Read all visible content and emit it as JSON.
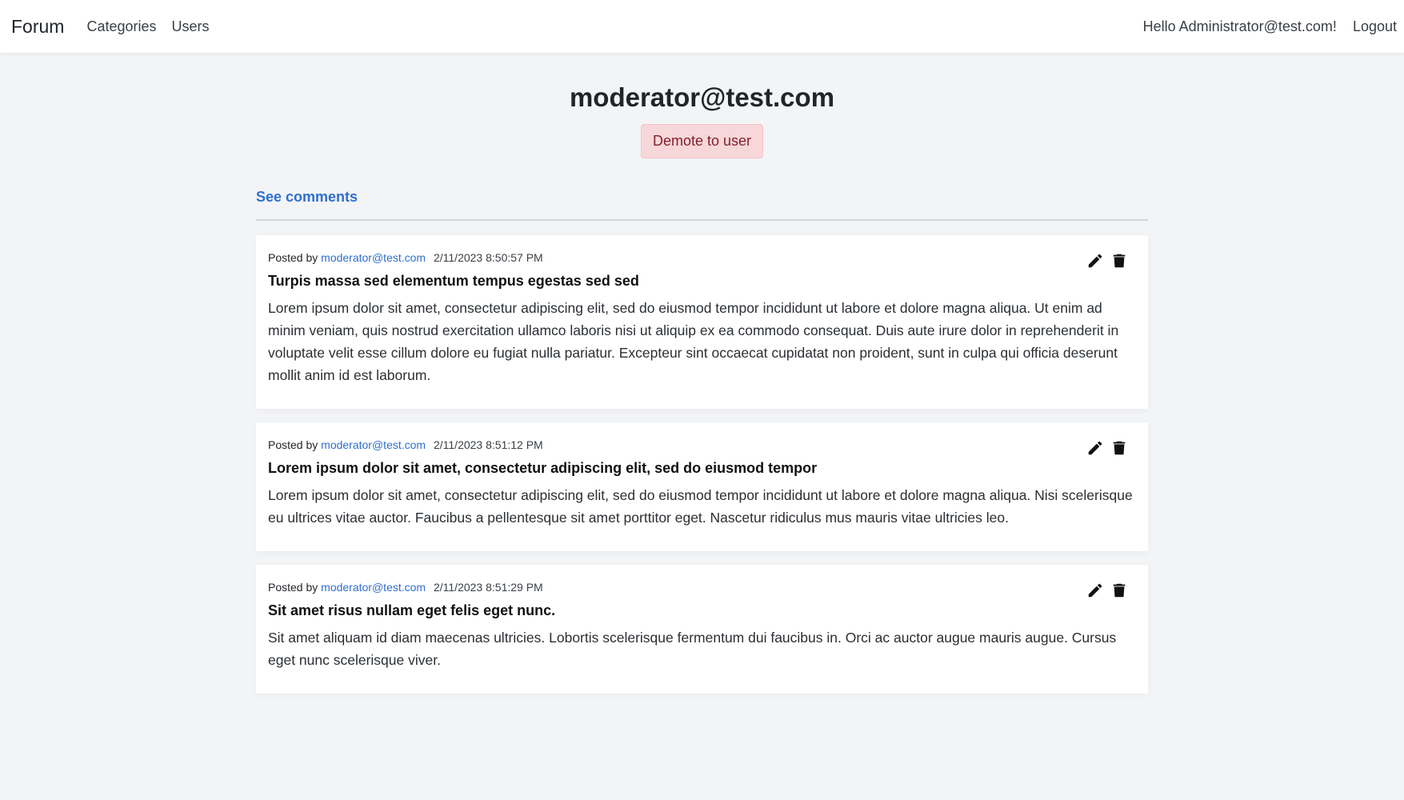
{
  "navbar": {
    "brand": "Forum",
    "links": [
      {
        "label": "Categories"
      },
      {
        "label": "Users"
      }
    ],
    "greeting": "Hello Administrator@test.com!",
    "logout_label": "Logout"
  },
  "profile": {
    "title": "moderator@test.com",
    "demote_label": "Demote to user",
    "see_comments_label": "See comments"
  },
  "posts": [
    {
      "posted_by_label": "Posted by",
      "author": "moderator@test.com",
      "date": "2/11/2023 8:50:57 PM",
      "title": "Turpis massa sed elementum tempus egestas sed sed",
      "body": "Lorem ipsum dolor sit amet, consectetur adipiscing elit, sed do eiusmod tempor incididunt ut labore et dolore magna aliqua. Ut enim ad minim veniam, quis nostrud exercitation ullamco laboris nisi ut aliquip ex ea commodo consequat. Duis aute irure dolor in reprehenderit in voluptate velit esse cillum dolore eu fugiat nulla pariatur. Excepteur sint occaecat cupidatat non proident, sunt in culpa qui officia deserunt mollit anim id est laborum."
    },
    {
      "posted_by_label": "Posted by",
      "author": "moderator@test.com",
      "date": "2/11/2023 8:51:12 PM",
      "title": "Lorem ipsum dolor sit amet, consectetur adipiscing elit, sed do eiusmod tempor",
      "body": "Lorem ipsum dolor sit amet, consectetur adipiscing elit, sed do eiusmod tempor incididunt ut labore et dolore magna aliqua. Nisi scelerisque eu ultrices vitae auctor. Faucibus a pellentesque sit amet porttitor eget. Nascetur ridiculus mus mauris vitae ultricies leo."
    },
    {
      "posted_by_label": "Posted by",
      "author": "moderator@test.com",
      "date": "2/11/2023 8:51:29 PM",
      "title": "Sit amet risus nullam eget felis eget nunc.",
      "body": "Sit amet aliquam id diam maecenas ultricies. Lobortis scelerisque fermentum dui faucibus in. Orci ac auctor augue mauris augue. Cursus eget nunc scelerisque viver."
    }
  ],
  "icons": {
    "edit": "pencil-icon",
    "delete": "trash-icon"
  },
  "colors": {
    "link": "#2f6fd0",
    "danger_bg": "#f8d7da",
    "danger_text": "#842029",
    "page_bg": "#f3f4f6"
  }
}
